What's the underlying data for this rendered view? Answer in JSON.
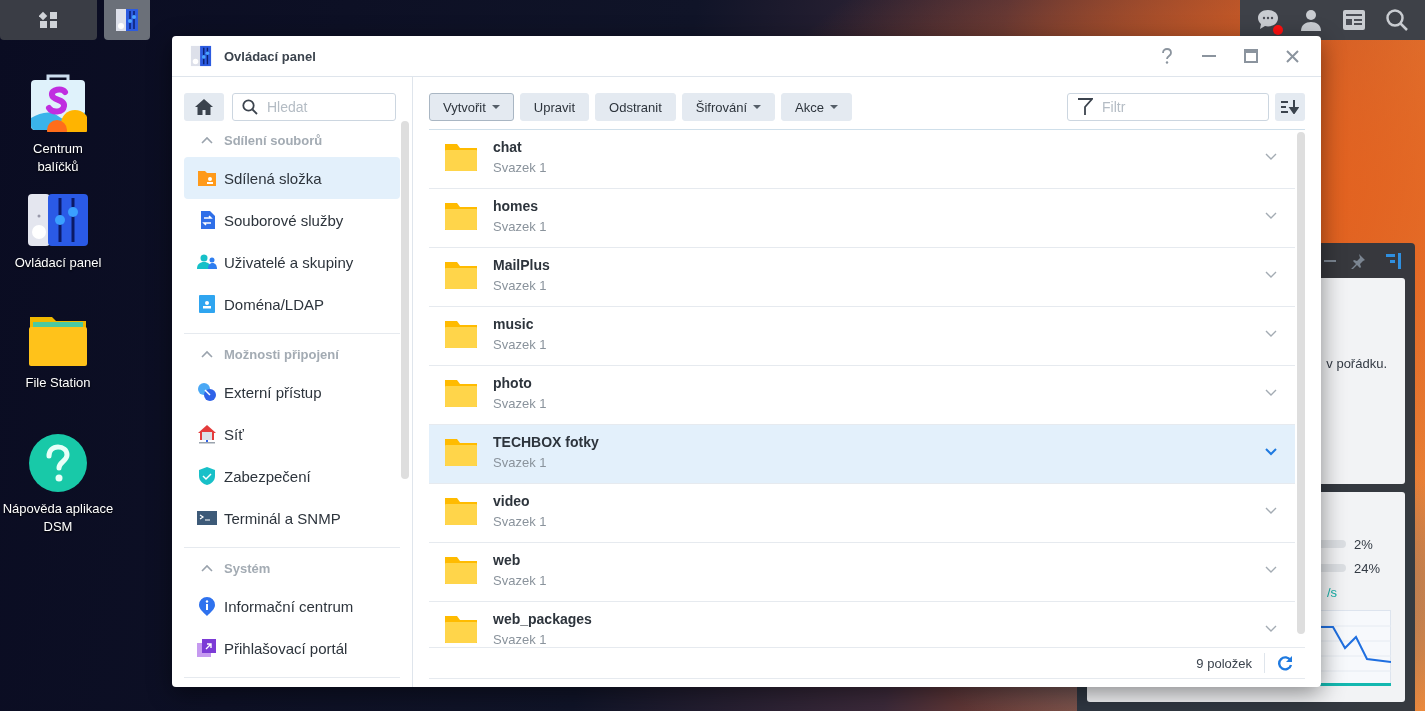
{
  "taskbar": {
    "buttons": [
      {
        "kind": "main-menu",
        "selected": false
      },
      {
        "kind": "control-panel",
        "selected": true
      }
    ]
  },
  "tray": {
    "notification": true
  },
  "desktop_icons": [
    {
      "kind": "package-center",
      "label": "Centrum\nbalíčků"
    },
    {
      "kind": "control-panel",
      "label": "Ovládací panel"
    },
    {
      "kind": "file-station",
      "label": "File Station"
    },
    {
      "kind": "help",
      "label": "Nápověda aplikace\nDSM"
    }
  ],
  "widget": {
    "status_text": "v pořádku.",
    "meters": [
      {
        "reading": "2%"
      },
      {
        "reading": "24%"
      }
    ],
    "rate": "/s"
  },
  "window": {
    "title": "Ovládací panel",
    "sidebar": {
      "search": {
        "placeholder": "Hledat"
      },
      "groups": [
        {
          "title": "Sdílení souborů",
          "expanded": true,
          "items": [
            {
              "label": "Sdílená složka",
              "selected": true
            },
            {
              "label": "Souborové služby",
              "selected": false
            },
            {
              "label": "Uživatelé a skupiny",
              "selected": false
            },
            {
              "label": "Doména/LDAP",
              "selected": false
            }
          ]
        },
        {
          "title": "Možnosti připojení",
          "expanded": true,
          "items": [
            {
              "label": "Externí přístup",
              "selected": false
            },
            {
              "label": "Síť",
              "selected": false
            },
            {
              "label": "Zabezpečení",
              "selected": false
            },
            {
              "label": "Terminál a SNMP",
              "selected": false
            }
          ]
        },
        {
          "title": "Systém",
          "expanded": true,
          "items": [
            {
              "label": "Informační centrum",
              "selected": false
            },
            {
              "label": "Přihlašovací portál",
              "selected": false
            }
          ]
        }
      ]
    },
    "toolbar": [
      {
        "label": "Vytvořit",
        "dropdown": true,
        "focused": true
      },
      {
        "label": "Upravit",
        "dropdown": false,
        "focused": false
      },
      {
        "label": "Odstranit",
        "dropdown": false,
        "focused": false
      },
      {
        "label": "Šifrování",
        "dropdown": true,
        "focused": false
      },
      {
        "label": "Akce",
        "dropdown": true,
        "focused": false
      }
    ],
    "filter": {
      "placeholder": "Filtr"
    },
    "rows": [
      {
        "name": "chat",
        "volume": "Svazek 1",
        "selected": false
      },
      {
        "name": "homes",
        "volume": "Svazek 1",
        "selected": false
      },
      {
        "name": "MailPlus",
        "volume": "Svazek 1",
        "selected": false
      },
      {
        "name": "music",
        "volume": "Svazek 1",
        "selected": false
      },
      {
        "name": "photo",
        "volume": "Svazek 1",
        "selected": false
      },
      {
        "name": "TECHBOX fotky",
        "volume": "Svazek 1",
        "selected": true
      },
      {
        "name": "video",
        "volume": "Svazek 1",
        "selected": false
      },
      {
        "name": "web",
        "volume": "Svazek 1",
        "selected": false
      },
      {
        "name": "web_packages",
        "volume": "Svazek 1",
        "selected": false
      }
    ],
    "footer": {
      "count": "9 položek"
    }
  }
}
